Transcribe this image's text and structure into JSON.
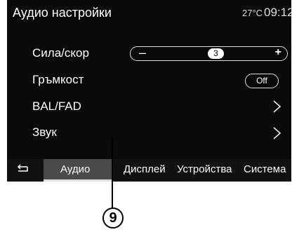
{
  "header": {
    "title": "Аудио настройки",
    "temperature": "27°C",
    "time": "09:12"
  },
  "settings": {
    "speed_volume": {
      "label": "Сила/скор",
      "minus": "–",
      "value": "3",
      "plus": "+"
    },
    "loudness": {
      "label": "Гръмкост",
      "toggle": "Off"
    },
    "bal_fad": {
      "label": "BAL/FAD"
    },
    "sound": {
      "label": "Звук"
    }
  },
  "tabs": {
    "audio": "Аудио",
    "display": "Дисплей",
    "devices": "Устройства",
    "system": "Система"
  },
  "callout": {
    "number": "9"
  }
}
